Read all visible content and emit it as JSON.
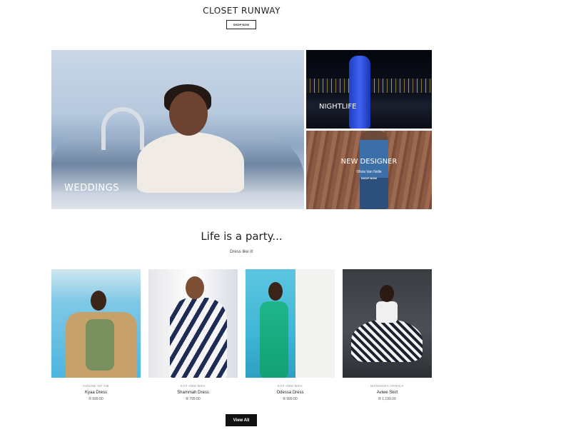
{
  "header": {
    "title": "CLOSET RUNWAY",
    "cta_label": "SHOP NOW"
  },
  "hero": {
    "weddings": {
      "label": "WEDDINGS"
    },
    "nightlife": {
      "label": "NIGHTLIFE"
    },
    "new_designer": {
      "label": "NEW DESIGNER",
      "designer_name": "Olivia Van Nolle",
      "cta_label": "SHOP NOW"
    }
  },
  "section": {
    "title": "Life is a party...",
    "subtitle": "Dress like it!"
  },
  "products": [
    {
      "brand": "HOUSE OF CB",
      "name": "Kyaa Dress",
      "price": "R 599.00"
    },
    {
      "brand": "KAT AND BOA",
      "name": "Shammah Dress",
      "price": "R 799.00"
    },
    {
      "brand": "KAT AND BOA",
      "name": "Odessa Dress",
      "price": "R 999.00"
    },
    {
      "brand": "MASHOSA AFRICA",
      "name": "Aviwe Skirt",
      "price": "R 1,199.00"
    }
  ],
  "footer": {
    "view_all_label": "View All"
  }
}
